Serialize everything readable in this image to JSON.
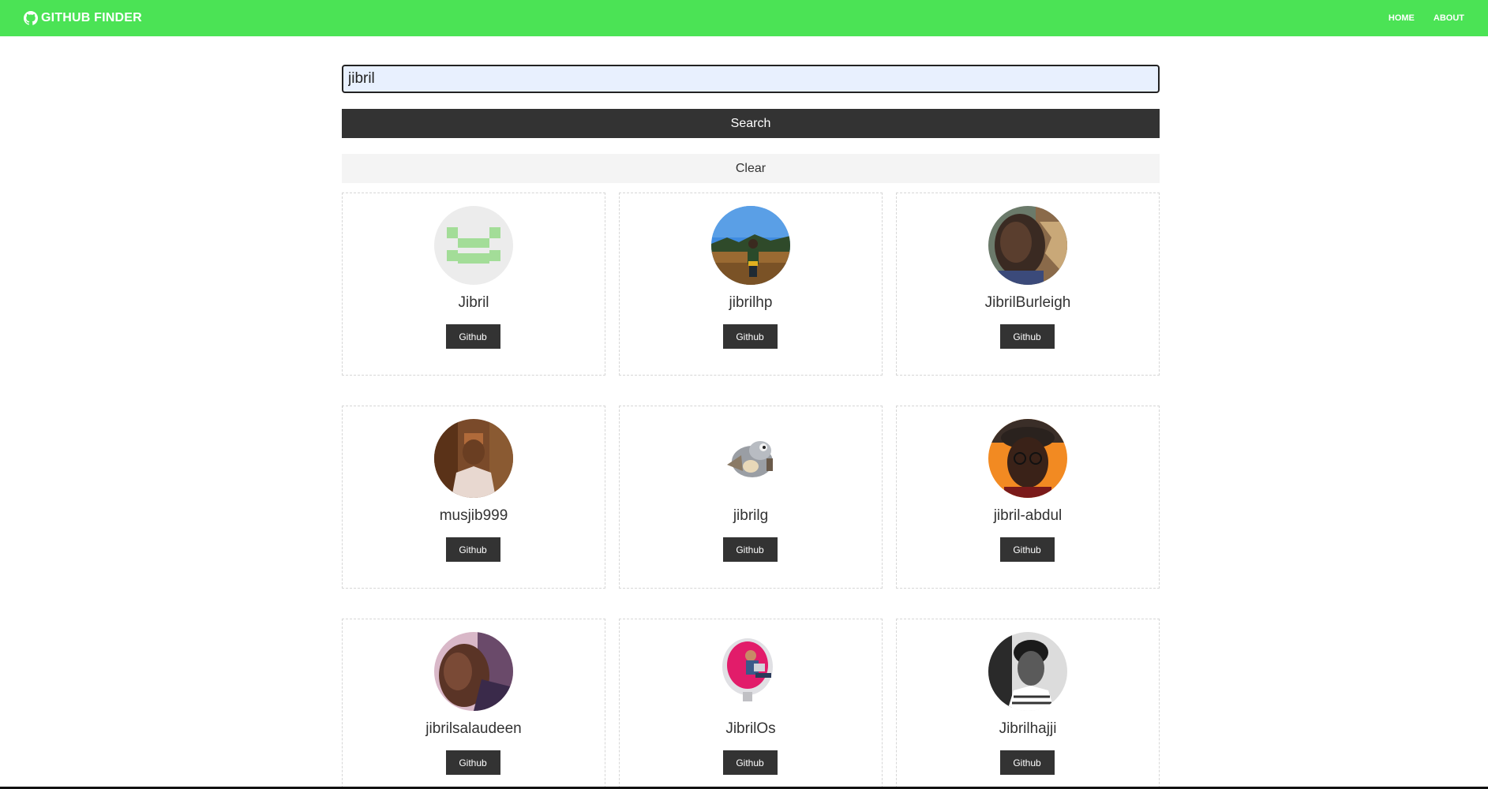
{
  "navbar": {
    "brand": "GITHUB FINDER",
    "brand_icon": "github-icon",
    "links": [
      "HOME",
      "ABOUT"
    ],
    "color": "#4be355"
  },
  "search": {
    "value": "jibril",
    "placeholder": "",
    "search_label": "Search",
    "clear_label": "Clear"
  },
  "users": [
    {
      "login": "Jibril",
      "button": "Github"
    },
    {
      "login": "jibrilhp",
      "button": "Github"
    },
    {
      "login": "JibrilBurleigh",
      "button": "Github"
    },
    {
      "login": "musjib999",
      "button": "Github"
    },
    {
      "login": "jibrilg",
      "button": "Github"
    },
    {
      "login": "jibril-abdul",
      "button": "Github"
    },
    {
      "login": "jibrilsalaudeen",
      "button": "Github"
    },
    {
      "login": "JibrilOs",
      "button": "Github"
    },
    {
      "login": "Jibrilhajji",
      "button": "Github"
    }
  ]
}
